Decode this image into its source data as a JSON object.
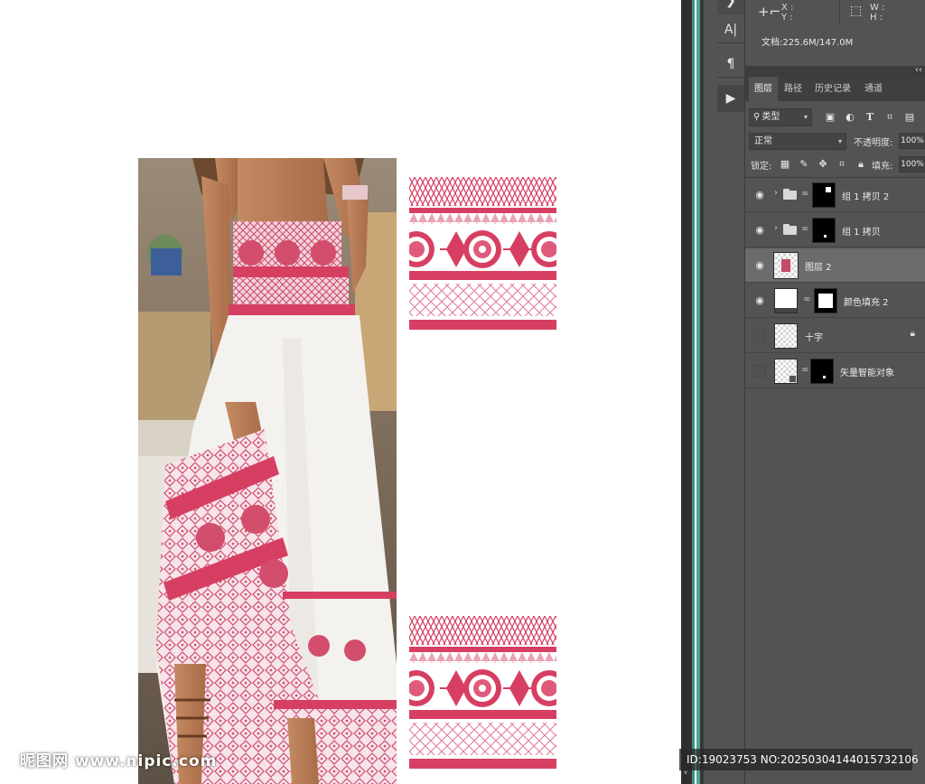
{
  "info": {
    "x_label": "X :",
    "y_label": "Y :",
    "w_label": "W :",
    "h_label": "H :",
    "doc": "文档:225.6M/147.0M"
  },
  "tabs": [
    {
      "label": "图层"
    },
    {
      "label": "路径"
    },
    {
      "label": "历史记录"
    },
    {
      "label": "通道"
    }
  ],
  "filter": {
    "label": "类型"
  },
  "blend": {
    "mode": "正常",
    "opacity_label": "不透明度:",
    "opacity": "100%"
  },
  "lock": {
    "label": "锁定:",
    "fill_label": "填充:",
    "fill": "100%"
  },
  "layers": [
    {
      "name": "组 1 拷贝 2",
      "visible": true,
      "type": "group"
    },
    {
      "name": "组 1 拷贝",
      "visible": true,
      "type": "group"
    },
    {
      "name": "图层 2",
      "visible": true,
      "type": "image",
      "selected": true
    },
    {
      "name": "颜色填充 2",
      "visible": true,
      "type": "fill"
    },
    {
      "name": "十字",
      "visible": false,
      "type": "pixel",
      "locked": true
    },
    {
      "name": "矢量智能对象",
      "visible": false,
      "type": "smart"
    }
  ],
  "watermark": {
    "logo": "昵图网 www.nipic.com",
    "id": "ID:19023753 NO:20250304144015732106"
  },
  "colors": {
    "accent_pink": "#d63f62",
    "panel_bg": "#535353",
    "panel_dark": "#3f3f3f",
    "teal_strip": "#4aa593"
  },
  "tools": {
    "character": "A|",
    "paragraph": "¶",
    "play": "▶"
  }
}
